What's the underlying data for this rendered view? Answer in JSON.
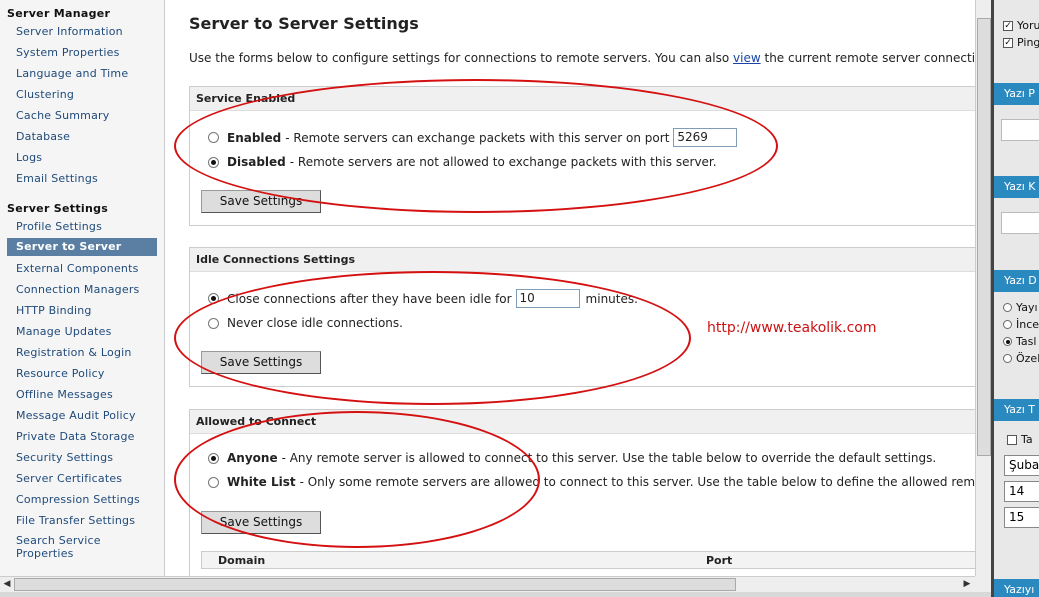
{
  "sidebar": {
    "server_manager_heading": "Server Manager",
    "server_manager_items": [
      "Server Information",
      "System Properties",
      "Language and Time",
      "Clustering",
      "Cache Summary",
      "Database",
      "Logs",
      "Email Settings"
    ],
    "server_settings_heading": "Server Settings",
    "server_settings_items": [
      "Profile Settings",
      "Server to Server",
      "External Components",
      "Connection Managers",
      "HTTP Binding",
      "Manage Updates",
      "Registration & Login",
      "Resource Policy",
      "Offline Messages",
      "Message Audit Policy",
      "Private Data Storage",
      "Security Settings",
      "Server Certificates",
      "Compression Settings",
      "File Transfer Settings",
      "Search Service Properties"
    ],
    "active_item": "Server to Server"
  },
  "main": {
    "title": "Server to Server Settings",
    "intro_before": "Use the forms below to configure settings for connections to remote servers. You can also",
    "intro_link": "view",
    "intro_after": "the current remote server connections.",
    "service_enabled": {
      "heading": "Service Enabled",
      "enabled_label": "Enabled",
      "enabled_desc": "- Remote servers can exchange packets with this server on port",
      "port_value": "5269",
      "disabled_label": "Disabled",
      "disabled_desc": "- Remote servers are not allowed to exchange packets with this server.",
      "selected": "disabled",
      "button": "Save Settings"
    },
    "idle_connections": {
      "heading": "Idle Connections Settings",
      "close_desc": "Close connections after they have been idle for",
      "idle_value": "10",
      "minutes_label": "minutes.",
      "never_desc": "Never close idle connections.",
      "selected": "close",
      "button": "Save Settings"
    },
    "allowed_to_connect": {
      "heading": "Allowed to Connect",
      "anyone_label": "Anyone",
      "anyone_desc": "- Any remote server is allowed to connect to this server. Use the table below to override the default settings.",
      "whitelist_label": "White List",
      "whitelist_desc": "- Only some remote servers are allowed to connect to this server. Use the table below to define the allowed remote ser",
      "selected": "anyone",
      "button": "Save Settings",
      "table_headers": [
        "Domain",
        "Port"
      ]
    },
    "watermark": "http://www.teakolik.com"
  },
  "right_panel": {
    "checkbox_items": [
      "Yoru",
      "Ping"
    ],
    "headers": [
      "Yazı P",
      "Yazı K",
      "Yazı D",
      "Yazı T",
      "Yazıyı"
    ],
    "radio_items": [
      "Yayı",
      "İnce",
      "Tasl",
      "Özel"
    ],
    "radio_selected": "Tasl",
    "checkbox_ta": "Ta",
    "fields": [
      "Şuba",
      "14",
      "15"
    ]
  },
  "colors": {
    "accent": "#5b7fa3",
    "link": "#1a44a8",
    "annotation": "#d41010",
    "right_header": "#2a8ac0"
  }
}
